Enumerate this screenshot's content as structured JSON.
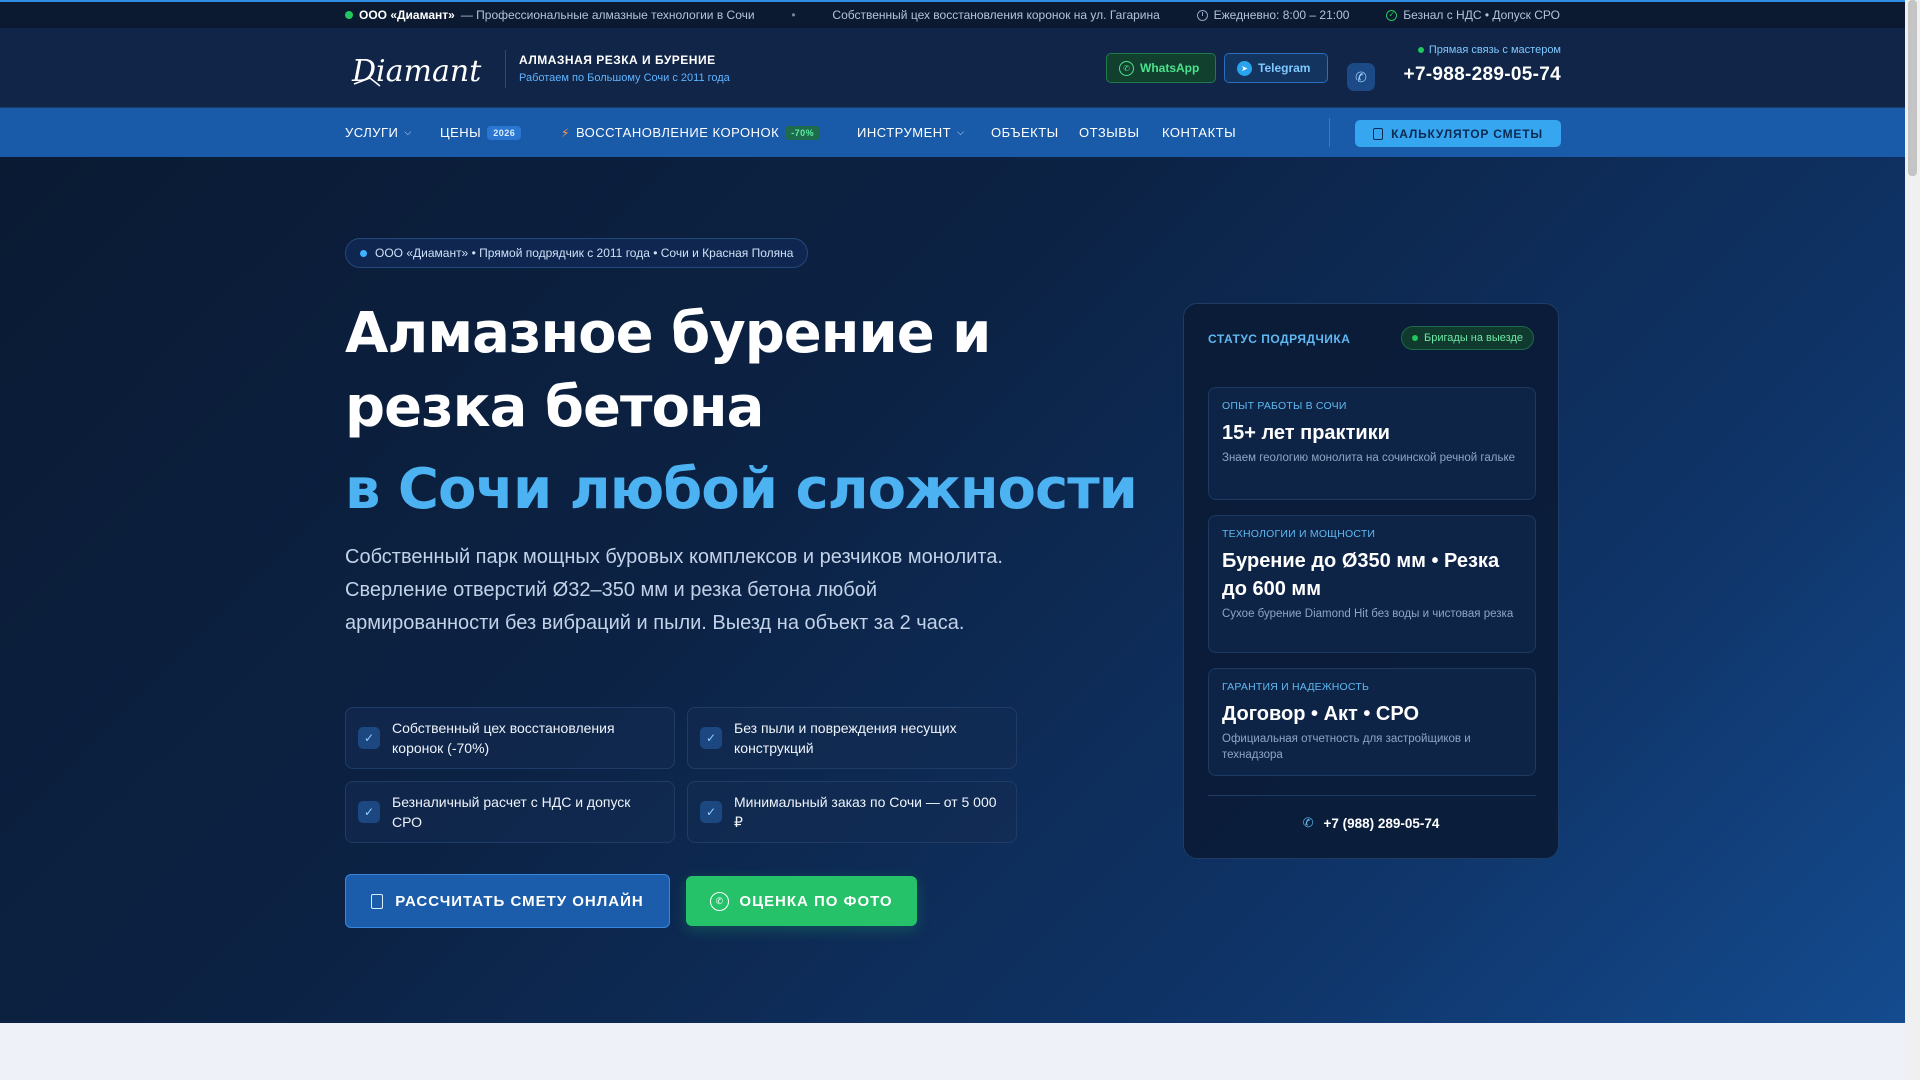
{
  "topbar": {
    "company": "ООО «Диамант»",
    "tagline": "— Профессиональные алмазные технологии в Сочи",
    "workshop": "Собственный цех восстановления коронок на ул. Гагарина",
    "hours": "Ежедневно: 8:00 – 21:00",
    "payment": "Безнал с НДС • Допуск СРО"
  },
  "header": {
    "logo_text": "Diamant",
    "title": "АЛМАЗНАЯ РЕЗКА И БУРЕНИЕ",
    "subtitle": "Работаем по Большому Сочи с 2011 года",
    "whatsapp_label": "WhatsApp",
    "telegram_label": "Telegram",
    "direct_label": "Прямая связь с мастером",
    "phone": "+7-988-289-05-74"
  },
  "nav": {
    "services": "УСЛУГИ",
    "prices": "ЦЕНЫ",
    "prices_badge": "2026",
    "restoration": "ВОССТАНОВЛЕНИЕ КОРОНОК",
    "restoration_badge": "-70%",
    "tools": "ИНСТРУМЕНТ",
    "objects": "ОБЪЕКТЫ",
    "reviews": "ОТЗЫВЫ",
    "contacts": "КОНТАКТЫ",
    "calculator": "КАЛЬКУЛЯТОР СМЕТЫ"
  },
  "hero": {
    "pill": "ООО «Диамант» • Прямой подрядчик с 2011 года • Сочи и Красная Поляна",
    "title": "Алмазное бурение и резка бетона",
    "title_accent": "в Сочи любой сложности",
    "lead": "Собственный парк мощных буровых комплексов и резчиков монолита. Сверление отверстий Ø32–350 мм и резка бетона любой армированности без вибраций и пыли. Выезд на объект за 2 часа.",
    "features": [
      "Собственный цех восстановления коронок (-70%)",
      "Без пыли и повреждения несущих конструкций",
      "Безналичный расчет с НДС и допуск СРО",
      "Минимальный заказ по Сочи — от 5 000 ₽"
    ],
    "cta_primary": "РАССЧИТАТЬ СМЕТУ ОНЛАЙН",
    "cta_secondary": "ОЦЕНКА ПО ФОТО"
  },
  "status_card": {
    "title": "СТАТУС ПОДРЯДЧИКА",
    "badge": "Бригады на выезде",
    "stats": [
      {
        "label": "ОПЫТ РАБОТЫ В СОЧИ",
        "value": "15+ лет практики",
        "desc": "Знаем геологию монолита на сочинской речной гальке"
      },
      {
        "label": "ТЕХНОЛОГИИ И МОЩНОСТИ",
        "value": "Бурение до Ø350 мм • Резка до 600 мм",
        "desc": "Сухое бурение Diamond Hit без воды и чистовая резка"
      },
      {
        "label": "ГАРАНТИЯ И НАДЕЖНОСТЬ",
        "value": "Договор • Акт • СРО",
        "desc": "Официальная отчетность для застройщиков и технадзора"
      }
    ],
    "phone": "+7 (988) 289-05-74"
  },
  "colors": {
    "accent": "#4cb2f2",
    "nav": "#1a5ba9",
    "whatsapp": "#25c26a",
    "status_ok": "#22c55e"
  },
  "icons": {
    "whatsapp": "whatsapp-icon",
    "telegram": "telegram-icon",
    "phone": "phone-icon",
    "calculator": "calculator-icon",
    "check": "check-icon",
    "clock": "clock-icon",
    "bolt": "bolt-icon"
  }
}
